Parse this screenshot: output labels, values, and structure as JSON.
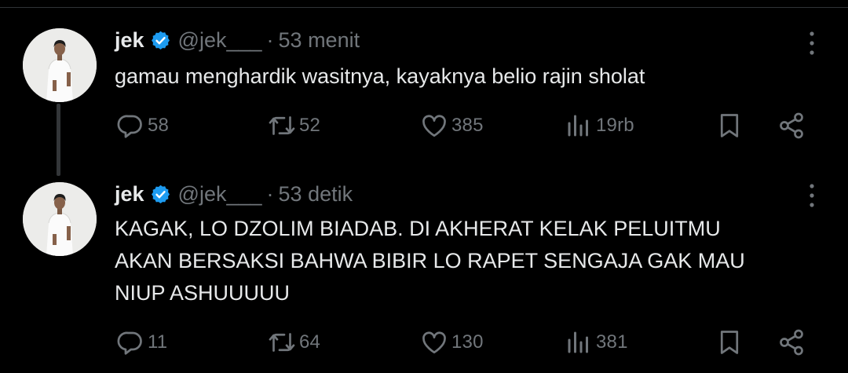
{
  "tweets": [
    {
      "name": "jek",
      "handle": "@jek___",
      "separator": "·",
      "time": "53 menit",
      "text": "gamau menghardik wasitnya, kayaknya belio rajin sholat",
      "replies": "58",
      "retweets": "52",
      "likes": "385",
      "views": "19rb"
    },
    {
      "name": "jek",
      "handle": "@jek___",
      "separator": "·",
      "time": "53 detik",
      "text": "KAGAK, LO DZOLIM BIADAB. DI AKHERAT KELAK PELUITMU\nAKAN BERSAKSI BAHWA BIBIR LO RAPET SENGAJA GAK MAU\nNIUP ASHUUUUU",
      "replies": "11",
      "retweets": "64",
      "likes": "130",
      "views": "381"
    }
  ],
  "colors": {
    "background": "#000000",
    "text": "#e7e9ea",
    "muted": "#71767b",
    "verified": "#1d9bf0"
  },
  "icons": [
    "verified-badge-icon",
    "more-icon",
    "reply-icon",
    "retweet-icon",
    "like-icon",
    "views-icon",
    "bookmark-icon",
    "share-icon"
  ]
}
